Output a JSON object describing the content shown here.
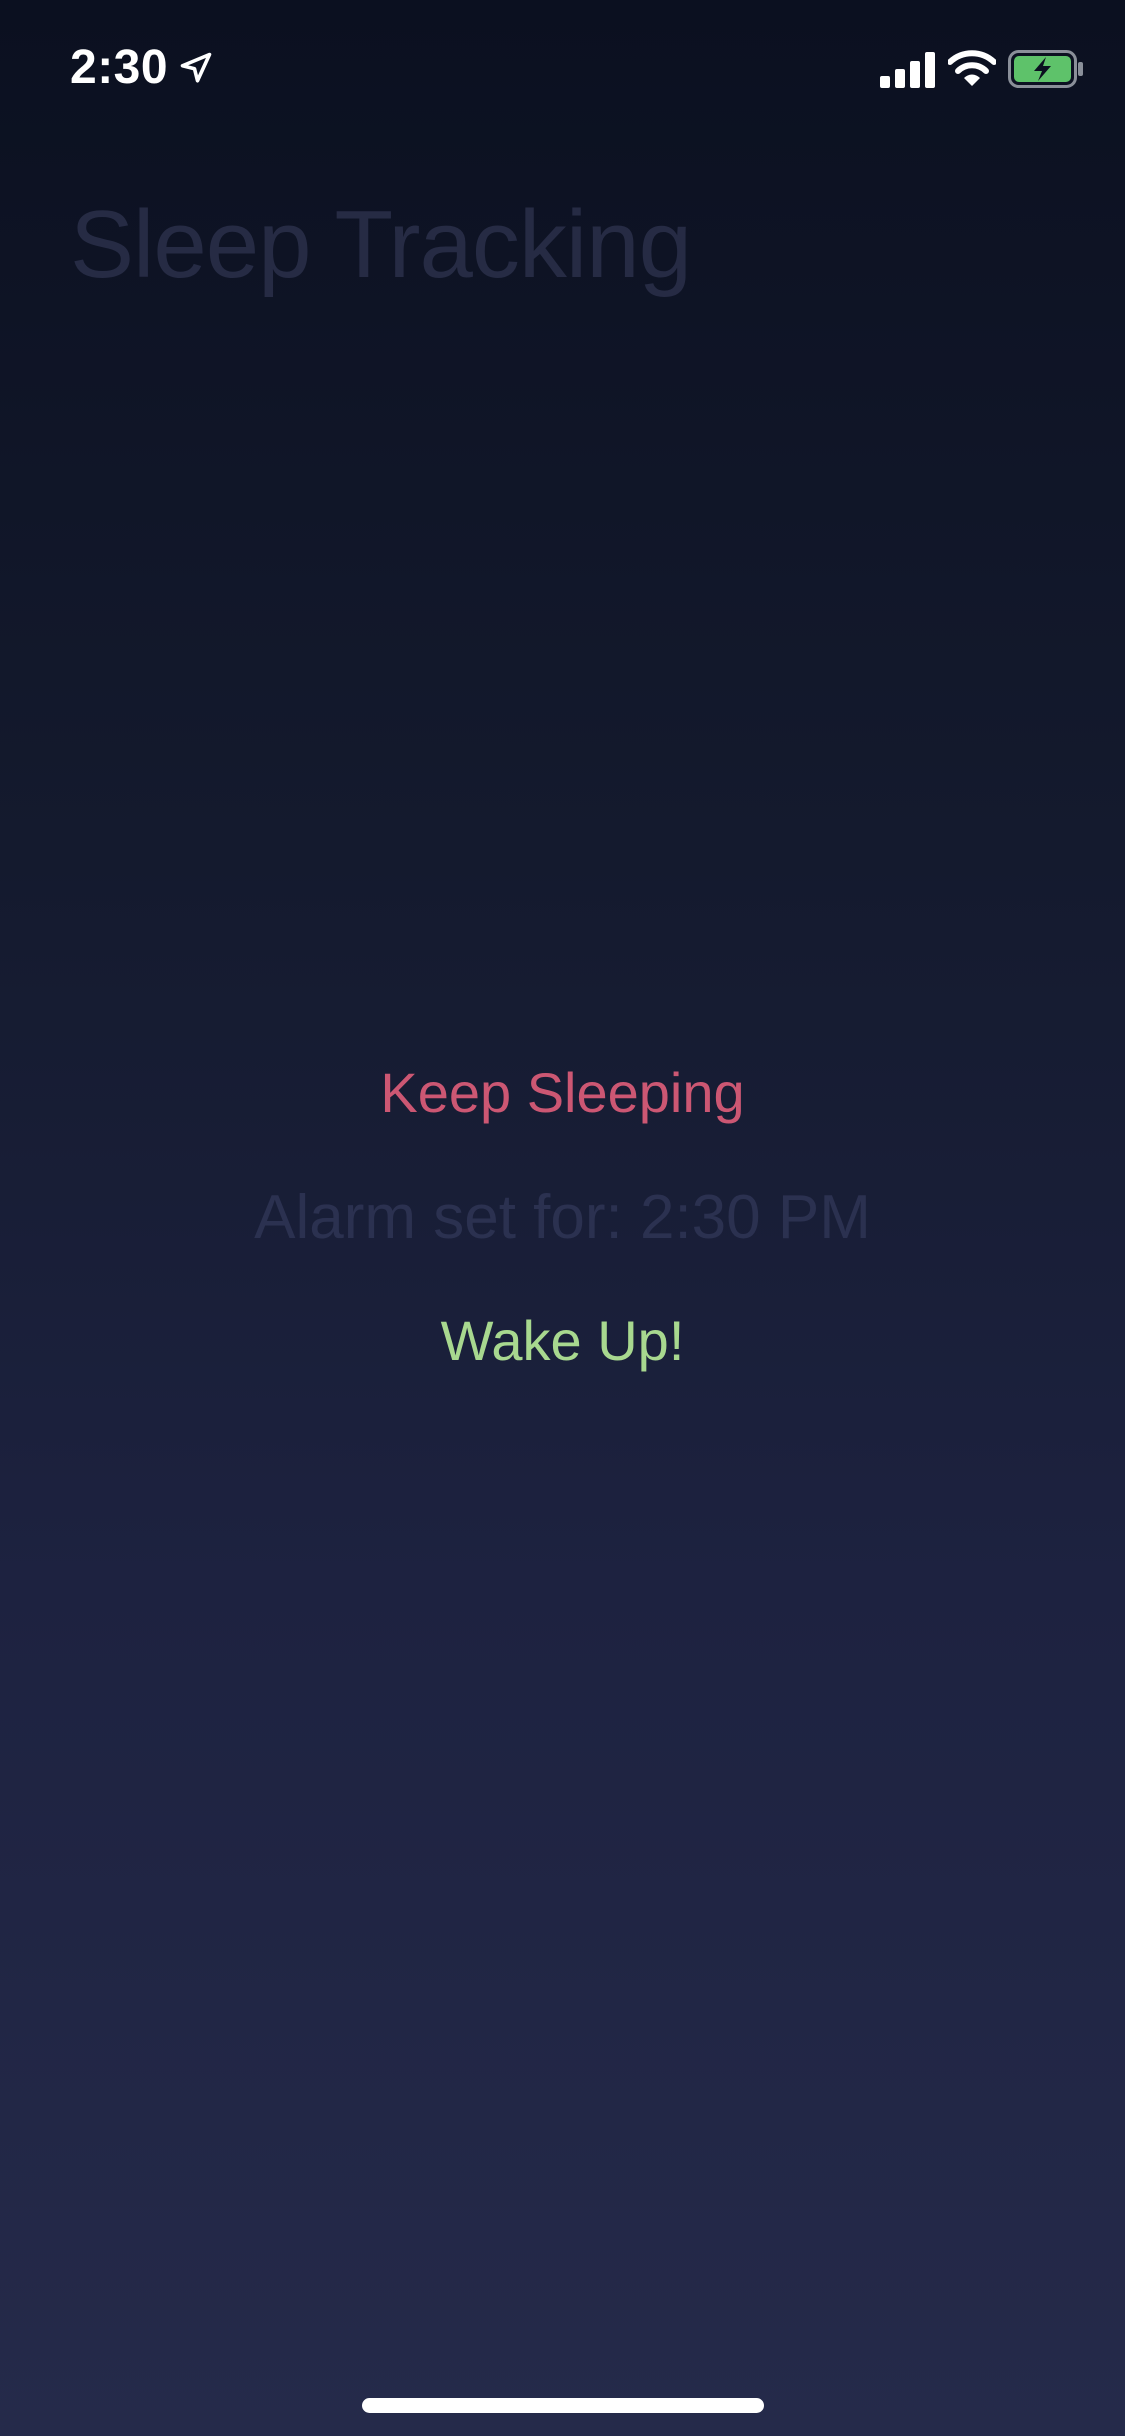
{
  "status_bar": {
    "time": "2:30",
    "icons": [
      "location-arrow-icon",
      "cellular-signal-icon",
      "wifi-icon",
      "battery-charging-icon"
    ],
    "battery_color": "#5ec26a"
  },
  "header": {
    "title": "Sleep Tracking"
  },
  "main": {
    "keep_sleeping_label": "Keep Sleeping",
    "alarm_text": "Alarm set for: 2:30 PM",
    "wake_up_label": "Wake Up!"
  },
  "colors": {
    "keep_sleeping": "#cc5773",
    "wake_up": "#a8d88f",
    "title": "#262b44",
    "alarm": "#2b3150"
  }
}
